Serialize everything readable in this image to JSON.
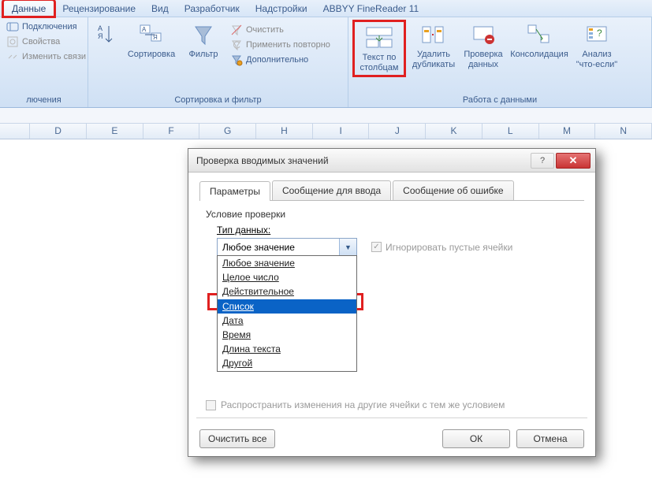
{
  "tabs": {
    "items": [
      "Данные",
      "Рецензирование",
      "Вид",
      "Разработчик",
      "Надстройки",
      "ABBYY FineReader 11"
    ],
    "active_index": 0
  },
  "ribbon": {
    "connections": {
      "refresh": "Подключения",
      "properties": "Свойства",
      "edit_links": "Изменить связи",
      "group_label": "лючения"
    },
    "sort_filter": {
      "sort": "Сортировка",
      "filter": "Фильтр",
      "clear": "Очистить",
      "reapply": "Применить повторно",
      "advanced": "Дополнительно",
      "group_label": "Сортировка и фильтр"
    },
    "data_tools": {
      "text_to_columns": "Текст по столбцам",
      "remove_duplicates": "Удалить дубликаты",
      "data_validation": "Проверка данных",
      "consolidate": "Консолидация",
      "what_if": "Анализ \"что-если\"",
      "group_label": "Работа с данными"
    }
  },
  "columns": [
    "",
    "D",
    "E",
    "F",
    "G",
    "H",
    "I",
    "J",
    "K",
    "L",
    "M",
    "N"
  ],
  "dialog": {
    "title": "Проверка вводимых значений",
    "tabs": [
      "Параметры",
      "Сообщение для ввода",
      "Сообщение об ошибке"
    ],
    "active_tab": 0,
    "criteria_label": "Условие проверки",
    "allow_label": "Тип данных:",
    "allow_value": "Любое значение",
    "ignore_blank": "Игнорировать пустые ячейки",
    "dropdown_options": [
      "Любое значение",
      "Целое число",
      "Действительное",
      "Список",
      "Дата",
      "Время",
      "Длина текста",
      "Другой"
    ],
    "selected_option_index": 3,
    "propagate": "Распространить изменения на другие ячейки с тем же условием",
    "clear_all": "Очистить все",
    "ok": "ОК",
    "cancel": "Отмена"
  }
}
